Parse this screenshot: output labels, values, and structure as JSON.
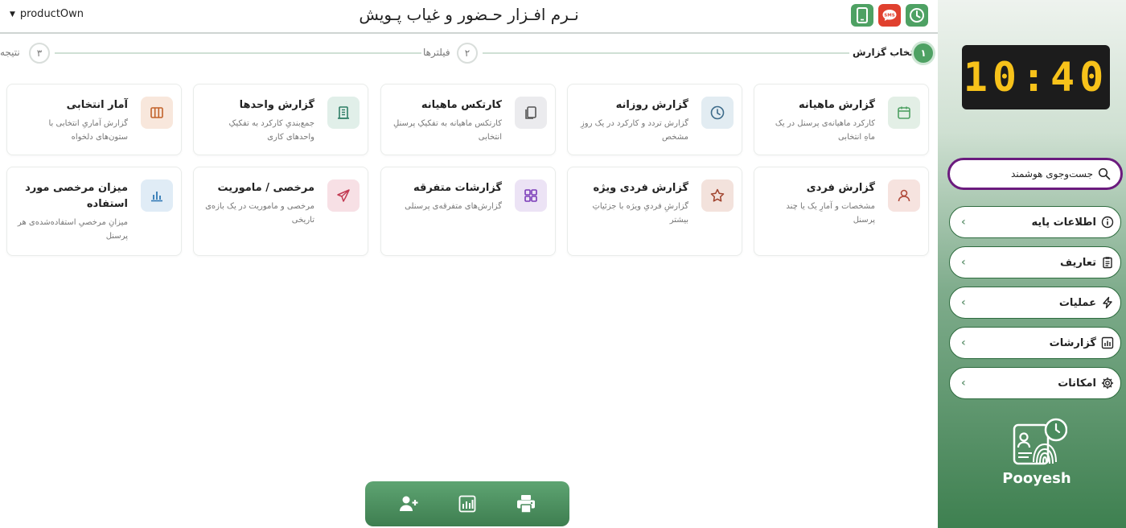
{
  "header": {
    "user_name": "productOwn",
    "app_title": "نـرم افـزار حـضور و غیاب پـویش",
    "buttons": [
      {
        "icon": "clock-icon"
      },
      {
        "icon": "sms-icon"
      },
      {
        "icon": "mobile-icon"
      }
    ]
  },
  "stepper": {
    "steps": [
      {
        "number": "۱",
        "label": "انتخاب گزارش",
        "active": true
      },
      {
        "number": "۲",
        "label": "فیلترها",
        "active": false
      },
      {
        "number": "۳",
        "label": "نتیجه",
        "active": false
      }
    ]
  },
  "reports": [
    {
      "title": "گزارش ماهیانه",
      "desc": "کارکرد ماهیانه‌ی پرسنل در یک ماهِ انتخابی",
      "icon": "calendar-icon",
      "color": "#4ea163",
      "bg": "#e3efe6"
    },
    {
      "title": "گزارش روزانه",
      "desc": "گزارش تردد و کارکرد در یک روزِ مشخص",
      "icon": "clock-icon",
      "color": "#3d6b8a",
      "bg": "#e2ecf2"
    },
    {
      "title": "کارتکس ماهیانه",
      "desc": "کارتکس ماهیانه به تفکیکِ پرسنلِ انتخابی",
      "icon": "copy-icon",
      "color": "#555",
      "bg": "#ebebee"
    },
    {
      "title": "گزارش واحدها",
      "desc": "جمع‌بندیِ کارکرد به تفکیکِ واحدهای کاری",
      "icon": "building-icon",
      "color": "#2e7e66",
      "bg": "#e1efe9"
    },
    {
      "title": "آمار انتخابی",
      "desc": "گزارش آماریِ انتخابی با ستون‌های دلخواه",
      "icon": "columns-icon",
      "color": "#c2622a",
      "bg": "#f8e7dc"
    },
    {
      "title": "گزارش فردی",
      "desc": "مشخصات و آمارِ یک یا چند پرسنل",
      "icon": "person-icon",
      "color": "#b04a3a",
      "bg": "#f6e3df"
    },
    {
      "title": "گزارش فردی ویژه",
      "desc": "گزارشِ فردیِ ویژه با جزئیاتِ بیشتر",
      "icon": "star-icon",
      "color": "#a0432e",
      "bg": "#f3e2dc"
    },
    {
      "title": "گزارشات متفرقه",
      "desc": "گزارش‌های متفرقه‌ی پرسنلی",
      "icon": "grid-icon",
      "color": "#7a3bb8",
      "bg": "#ece3f5"
    },
    {
      "title": "مرخصی / ماموریت",
      "desc": "مرخصی و ماموریت در یک بازه‌ی تاریخی",
      "icon": "plane-icon",
      "color": "#c23a52",
      "bg": "#f7e0e5"
    },
    {
      "title": "میزان مرخصی مورد استفاده",
      "desc": "میزانِ مرخصیِ استفاده‌شده‌ی هر پرسنل",
      "icon": "bar-chart-icon",
      "color": "#2f78b5",
      "bg": "#e0ecf6"
    }
  ],
  "sidebar": {
    "clock": "10:40",
    "search_placeholder": "جست‌وجوی هوشمند",
    "menu": [
      {
        "label": "اطلاعات پایه",
        "icon": "info-icon"
      },
      {
        "label": "تعاریف",
        "icon": "clipboard-icon"
      },
      {
        "label": "عملیات",
        "icon": "bolt-icon"
      },
      {
        "label": "گزارشات",
        "icon": "report-icon"
      },
      {
        "label": "امکانات",
        "icon": "settings-icon"
      }
    ],
    "logo_text": "Pooyesh"
  },
  "toolbar": {
    "buttons": [
      {
        "icon": "add-user-icon"
      },
      {
        "icon": "chart-icon"
      },
      {
        "icon": "printer-icon"
      }
    ]
  }
}
